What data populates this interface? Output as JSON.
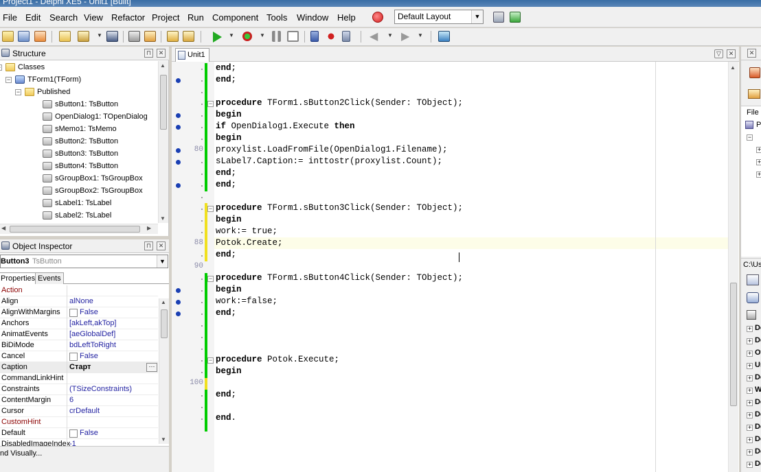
{
  "window": {
    "title": "Project1 - Delphi XE5 - Unit1 [Built]"
  },
  "menu": [
    "File",
    "Edit",
    "Search",
    "View",
    "Refactor",
    "Project",
    "Run",
    "Component",
    "Tools",
    "Window",
    "Help"
  ],
  "layout_select": {
    "value": "Default Layout"
  },
  "structure": {
    "title": "Structure",
    "items": [
      {
        "label": "Classes",
        "level": 0,
        "kind": "folder",
        "expander": "−"
      },
      {
        "label": "TForm1(TForm)",
        "level": 1,
        "kind": "form",
        "expander": "−"
      },
      {
        "label": "Published",
        "level": 2,
        "kind": "folder",
        "expander": "−"
      },
      {
        "label": "sButton1: TsButton",
        "level": 3,
        "kind": "comp"
      },
      {
        "label": "OpenDialog1: TOpenDialog",
        "level": 3,
        "kind": "comp"
      },
      {
        "label": "sMemo1: TsMemo",
        "level": 3,
        "kind": "comp"
      },
      {
        "label": "sButton2: TsButton",
        "level": 3,
        "kind": "comp"
      },
      {
        "label": "sButton3: TsButton",
        "level": 3,
        "kind": "comp"
      },
      {
        "label": "sButton4: TsButton",
        "level": 3,
        "kind": "comp"
      },
      {
        "label": "sGroupBox1: TsGroupBox",
        "level": 3,
        "kind": "comp"
      },
      {
        "label": "sGroupBox2: TsGroupBox",
        "level": 3,
        "kind": "comp"
      },
      {
        "label": "sLabel1: TsLabel",
        "level": 3,
        "kind": "comp"
      },
      {
        "label": "sLabel2: TsLabel",
        "level": 3,
        "kind": "comp"
      }
    ]
  },
  "inspector": {
    "title": "Object Inspector",
    "object_name": "Button3",
    "object_class": "TsButton",
    "tabs": [
      "Properties",
      "Events"
    ],
    "active_tab": 0,
    "properties": [
      {
        "name": "Action",
        "value": "",
        "name_color": "#8b0000"
      },
      {
        "name": "Align",
        "value": "alNone"
      },
      {
        "name": "AlignWithMargins",
        "value": "False",
        "checkbox": true
      },
      {
        "name": "Anchors",
        "value": "[akLeft,akTop]",
        "expander": true
      },
      {
        "name": "AnimatEvents",
        "value": "[aeGlobalDef]",
        "expander": true
      },
      {
        "name": "BiDiMode",
        "value": "bdLeftToRight"
      },
      {
        "name": "Cancel",
        "value": "False",
        "checkbox": true
      },
      {
        "name": "Caption",
        "value": "Старт",
        "selected": true,
        "bold": true
      },
      {
        "name": "CommandLinkHint",
        "value": ""
      },
      {
        "name": "Constraints",
        "value": "(TSizeConstraints)",
        "expander": true
      },
      {
        "name": "ContentMargin",
        "value": "6"
      },
      {
        "name": "Cursor",
        "value": "crDefault"
      },
      {
        "name": "CustomHint",
        "value": "",
        "name_color": "#8b0000"
      },
      {
        "name": "Default",
        "value": "False",
        "checkbox": true
      },
      {
        "name": "DisabledImageIndex",
        "value": "-1"
      }
    ],
    "status": "nd Visually..."
  },
  "editor": {
    "tab": "Unit1",
    "lines": [
      {
        "text": "end;"
      },
      {
        "text": "end;"
      },
      {
        "text": ""
      },
      {
        "text": "procedure TForm1.sButton2Click(Sender: TObject);"
      },
      {
        "text": "begin"
      },
      {
        "text": "if OpenDialog1.Execute then"
      },
      {
        "text": "begin"
      },
      {
        "text": "proxylist.LoadFromFile(OpenDialog1.Filename);"
      },
      {
        "text": "sLabel7.Caption:= inttostr(proxylist.Count);"
      },
      {
        "text": "end;"
      },
      {
        "text": "end;"
      },
      {
        "text": ""
      },
      {
        "text": "procedure TForm1.sButton3Click(Sender: TObject);"
      },
      {
        "text": "begin"
      },
      {
        "text": "work:= true;"
      },
      {
        "text": "Potok.Create;"
      },
      {
        "text": "end;"
      },
      {
        "text": ""
      },
      {
        "text": "procedure TForm1.sButton4Click(Sender: TObject);"
      },
      {
        "text": "begin"
      },
      {
        "text": "work:=false;"
      },
      {
        "text": "end;"
      },
      {
        "text": ""
      },
      {
        "text": ""
      },
      {
        "text": ""
      },
      {
        "text": "procedure Potok.Execute;"
      },
      {
        "text": "begin"
      },
      {
        "text": ""
      },
      {
        "text": "end;"
      },
      {
        "text": ""
      },
      {
        "text": "end."
      }
    ],
    "line_numbers": [
      {
        "row": 7,
        "label": "80"
      },
      {
        "row": 15,
        "label": "88"
      },
      {
        "row": 17,
        "label": "90"
      },
      {
        "row": 27,
        "label": "100"
      }
    ],
    "breakpoint_rows": [
      1,
      4,
      5,
      7,
      8,
      10,
      19,
      20,
      21
    ]
  },
  "right_dock": {
    "file_tab": "File",
    "tree_root": "P",
    "path": "C:\\Us",
    "groups": [
      "De",
      "De",
      "Ot",
      "Un",
      "De",
      "W",
      "De",
      "De",
      "De",
      "De",
      "De",
      "De"
    ]
  },
  "colors": {
    "change_saved": "#00cc00",
    "change_unsaved": "#f0e020",
    "breakpoint": "#1a3fb3",
    "current_line": "#fdfde8"
  }
}
